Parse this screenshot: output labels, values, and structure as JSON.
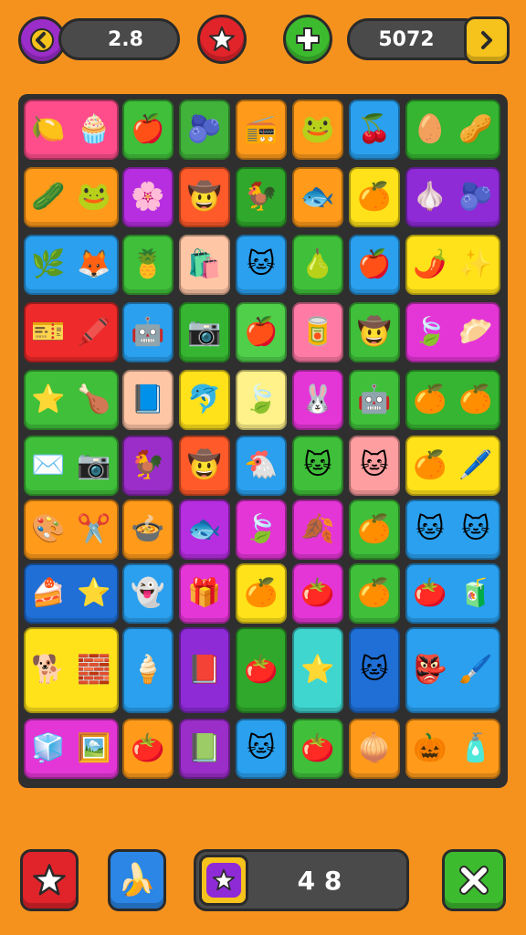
{
  "hud": {
    "level": "2.8",
    "score": "5072",
    "colors": {
      "back": "#9b2dc9",
      "star": "#e0242a",
      "plus": "#3dbb2f",
      "next": "#f6c21c"
    }
  },
  "bottom": {
    "counter": "4 8",
    "colors": {
      "star": "#e0242a",
      "banana": "#2b86e6",
      "close": "#3dbb2f"
    }
  },
  "board": {
    "rows": [
      [
        {
          "c": "#ff4d8c",
          "w": 2,
          "g": [
            "🍋",
            "🧁"
          ]
        },
        {
          "c": "#3fbf3a",
          "g": [
            "🍎"
          ]
        },
        {
          "c": "#41b23a",
          "g": [
            "🫐"
          ]
        },
        {
          "c": "#ff9a1a",
          "g": [
            "📻"
          ]
        },
        {
          "c": "#ff9a1a",
          "g": [
            "🐸"
          ]
        },
        {
          "c": "#2aa0ef",
          "g": [
            "🍒"
          ]
        },
        {
          "c": "#35b531",
          "w": 2,
          "g": [
            "🥚",
            "🥜"
          ]
        }
      ],
      [
        {
          "c": "#ff9a1a",
          "w": 2,
          "g": [
            "🥒",
            "🐸"
          ]
        },
        {
          "c": "#b62ee0",
          "g": [
            "🌸"
          ]
        },
        {
          "c": "#ff5a2a",
          "g": [
            "🤠"
          ]
        },
        {
          "c": "#2fa82b",
          "g": [
            "🐓"
          ]
        },
        {
          "c": "#ff9a1a",
          "g": [
            "🐟"
          ]
        },
        {
          "c": "#ffe21a",
          "g": [
            "🍊"
          ]
        },
        {
          "c": "#8e2bd6",
          "w": 2,
          "g": [
            "🧄",
            "🫐"
          ]
        }
      ],
      [
        {
          "c": "#2aa0ef",
          "w": 2,
          "g": [
            "🌿",
            "🦊"
          ]
        },
        {
          "c": "#3fbf3a",
          "g": [
            "🍍"
          ]
        },
        {
          "c": "#ffc6a6",
          "g": [
            "🛍️"
          ]
        },
        {
          "c": "#2aa0ef",
          "g": [
            "🐱"
          ]
        },
        {
          "c": "#3fbf3a",
          "g": [
            "🍐"
          ]
        },
        {
          "c": "#2aa0ef",
          "g": [
            "🍎"
          ]
        },
        {
          "c": "#ffe21a",
          "w": 2,
          "g": [
            "🌶️",
            "✨"
          ]
        }
      ],
      [
        {
          "c": "#ee2a2a",
          "w": 2,
          "g": [
            "🎫",
            "🖍️"
          ]
        },
        {
          "c": "#2aa0ef",
          "g": [
            "🤖"
          ]
        },
        {
          "c": "#35b531",
          "g": [
            "📷"
          ]
        },
        {
          "c": "#4fcf4a",
          "g": [
            "🍎"
          ]
        },
        {
          "c": "#ff7aa5",
          "g": [
            "🥫"
          ]
        },
        {
          "c": "#3fbf3a",
          "g": [
            "🤠"
          ]
        },
        {
          "c": "#e436d6",
          "w": 2,
          "g": [
            "🍃",
            "🥟"
          ]
        }
      ],
      [
        {
          "c": "#3fbf3a",
          "w": 2,
          "g": [
            "⭐",
            "🍗"
          ]
        },
        {
          "c": "#ffc6a6",
          "g": [
            "📘"
          ]
        },
        {
          "c": "#ffe21a",
          "g": [
            "🐬"
          ]
        },
        {
          "c": "#fff28a",
          "g": [
            "🍃"
          ]
        },
        {
          "c": "#e436d6",
          "g": [
            "🐰"
          ]
        },
        {
          "c": "#3fbf3a",
          "g": [
            "🤖"
          ]
        },
        {
          "c": "#35b531",
          "w": 2,
          "g": [
            "🍊",
            "🍊"
          ]
        }
      ],
      [
        {
          "c": "#3fbf3a",
          "w": 2,
          "g": [
            "✉️",
            "📷"
          ]
        },
        {
          "c": "#9b2dc9",
          "g": [
            "🐓"
          ]
        },
        {
          "c": "#ff5a2a",
          "g": [
            "🤠"
          ]
        },
        {
          "c": "#2aa0ef",
          "g": [
            "🐔"
          ]
        },
        {
          "c": "#3fbf3a",
          "g": [
            "🐱"
          ]
        },
        {
          "c": "#ff9ea0",
          "g": [
            "🐱"
          ]
        },
        {
          "c": "#ffe21a",
          "w": 2,
          "g": [
            "🍊",
            "🖊️"
          ]
        }
      ],
      [
        {
          "c": "#ff9a1a",
          "w": 2,
          "g": [
            "🎨",
            "✂️"
          ]
        },
        {
          "c": "#ff9a1a",
          "g": [
            "🍲"
          ]
        },
        {
          "c": "#b62ee0",
          "g": [
            "🐟"
          ]
        },
        {
          "c": "#e436d6",
          "g": [
            "🍃"
          ]
        },
        {
          "c": "#e436d6",
          "g": [
            "🍂"
          ]
        },
        {
          "c": "#3fbf3a",
          "g": [
            "🍊"
          ]
        },
        {
          "c": "#2aa0ef",
          "w": 2,
          "g": [
            "🐱",
            "🐱"
          ]
        }
      ],
      [
        {
          "c": "#1f6fd6",
          "w": 2,
          "g": [
            "🍰",
            "⭐"
          ]
        },
        {
          "c": "#2aa0ef",
          "g": [
            "👻"
          ]
        },
        {
          "c": "#e436d6",
          "g": [
            "🎁"
          ]
        },
        {
          "c": "#ffe21a",
          "g": [
            "🍊"
          ]
        },
        {
          "c": "#e436d6",
          "g": [
            "🍅"
          ]
        },
        {
          "c": "#3fbf3a",
          "g": [
            "🍊"
          ]
        },
        {
          "c": "#2aa0ef",
          "w": 2,
          "g": [
            "🍅",
            "🧃"
          ]
        }
      ],
      [
        {
          "c": "#ffe21a",
          "w": 2,
          "h": 2,
          "g": [
            "🐕",
            "🧱"
          ]
        },
        {
          "c": "#2aa0ef",
          "h": 2,
          "g": [
            "🍦"
          ]
        },
        {
          "c": "#8e2bd6",
          "h": 2,
          "g": [
            "📕"
          ]
        },
        {
          "c": "#2fa82b",
          "h": 2,
          "g": [
            "🍅"
          ]
        },
        {
          "c": "#3fd6d0",
          "h": 2,
          "g": [
            "⭐"
          ]
        },
        {
          "c": "#1f6fd6",
          "h": 2,
          "g": [
            "🐱"
          ]
        },
        {
          "c": "#2aa0ef",
          "w": 2,
          "h": 2,
          "g": [
            "👺",
            "🖌️"
          ]
        }
      ],
      [
        {
          "c": "#e436d6",
          "w": 2,
          "g": [
            "🧊",
            "🖼️"
          ]
        },
        {
          "c": "#ff9a1a",
          "g": [
            "🍅"
          ]
        },
        {
          "c": "#9b2dc9",
          "g": [
            "📗"
          ]
        },
        {
          "c": "#2aa0ef",
          "g": [
            "🐱"
          ]
        },
        {
          "c": "#3fbf3a",
          "g": [
            "🍅"
          ]
        },
        {
          "c": "#ff9a1a",
          "g": [
            "🧅"
          ]
        },
        {
          "c": "#ff9a1a",
          "w": 2,
          "g": [
            "🎃",
            "🧴"
          ]
        }
      ]
    ]
  }
}
